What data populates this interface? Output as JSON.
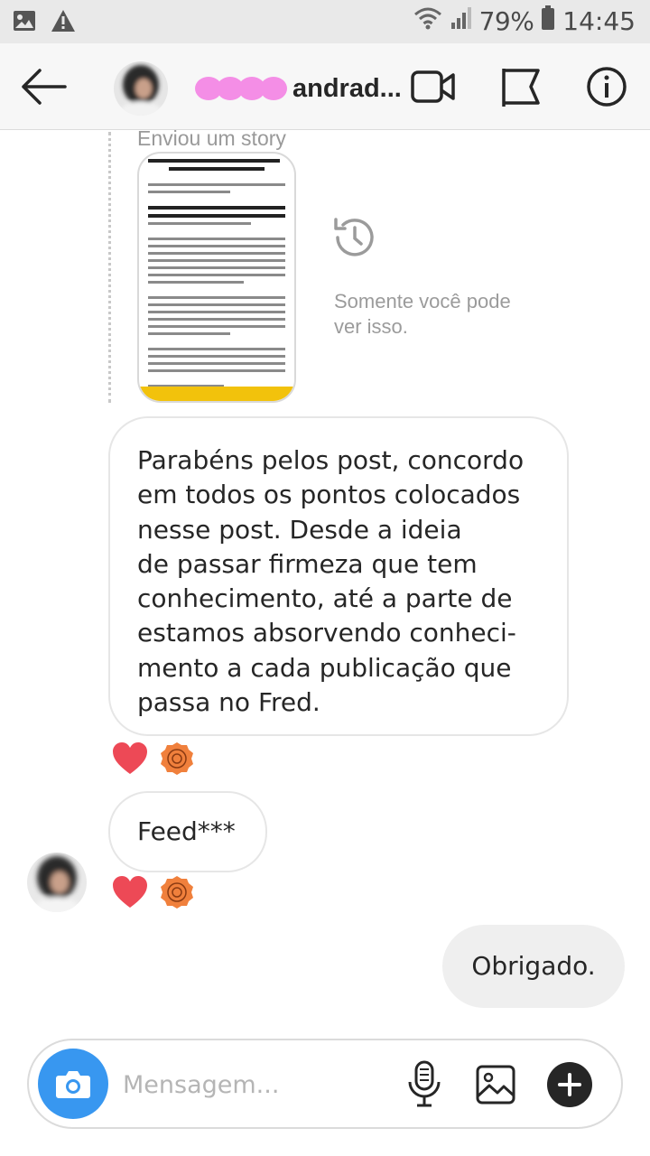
{
  "status_bar": {
    "battery_percent": "79%",
    "time": "14:45",
    "icons": [
      "image-notification-icon",
      "warning-icon",
      "wifi-icon",
      "signal-icon",
      "battery-icon"
    ]
  },
  "header": {
    "username": "andrad...",
    "icons": [
      "back-arrow-icon",
      "video-call-icon",
      "flag-icon",
      "info-icon"
    ]
  },
  "story": {
    "label": "Enviou um story",
    "only_you_text": "Somente você pode ver isso."
  },
  "messages": [
    {
      "direction": "incoming",
      "text": "Parabéns pelos post, concordo em todos os pontos colocados nesse post. Desde a ideia de passar firmeza que tem conhecimento, até  a parte de estamos absorvendo conheci-mento a cada publicação que passa no Fred.",
      "lines": [
        "Parabéns pelos post, concordo",
        "em todos os pontos colocados",
        "nesse post. Desde a ideia",
        "de passar firmeza que tem",
        "conhecimento, até  a parte de",
        "estamos absorvendo conheci-",
        "mento a cada publicação que",
        "passa no Fred."
      ],
      "reactions": [
        "heart-icon",
        "sticker-icon"
      ]
    },
    {
      "direction": "incoming",
      "text": "Feed***",
      "reactions": [
        "heart-icon",
        "sticker-icon"
      ]
    },
    {
      "direction": "outgoing",
      "text": "Obrigado."
    }
  ],
  "composer": {
    "placeholder": "Mensagem...",
    "icons": [
      "camera-icon",
      "microphone-icon",
      "gallery-icon",
      "plus-icon"
    ]
  },
  "colors": {
    "accent": "#3897f0",
    "heart": "#ed4956",
    "sticker": "#f0803c",
    "name_redaction": "#f48ee6",
    "story_bar": "#f2c20c"
  }
}
